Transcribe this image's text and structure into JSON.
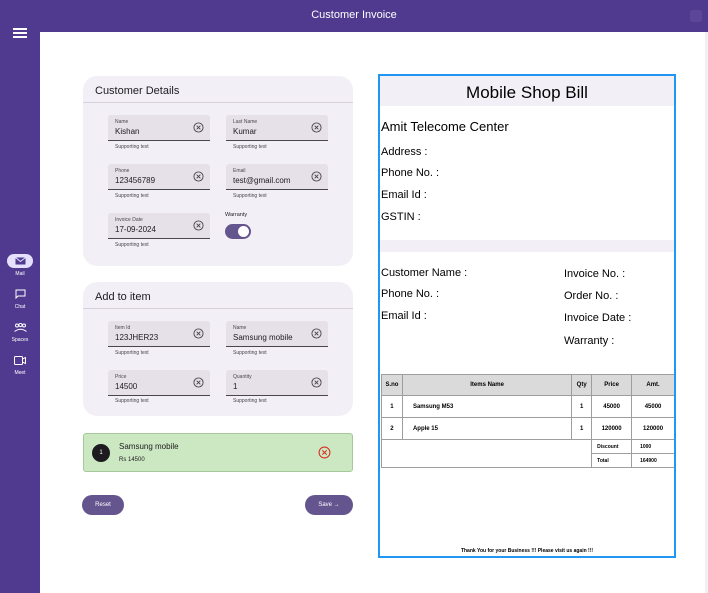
{
  "app": {
    "title": "Customer Invoice"
  },
  "nav": [
    {
      "label": "Mail",
      "icon": "mail-icon"
    },
    {
      "label": "Chat",
      "icon": "chat-icon"
    },
    {
      "label": "Spaces",
      "icon": "spaces-icon"
    },
    {
      "label": "Meet",
      "icon": "meet-icon"
    }
  ],
  "customer": {
    "title": "Customer Details",
    "name": {
      "label": "Name",
      "value": "Kishan",
      "support": "Supporting text"
    },
    "last_name": {
      "label": "Last Name",
      "value": "Kumar",
      "support": "Supporting text"
    },
    "phone": {
      "label": "Phone",
      "value": "123456789",
      "support": "Supporting text"
    },
    "email": {
      "label": "Email",
      "value": "test@gmail.com",
      "support": "Supporting text"
    },
    "invoice_date": {
      "label": "Invoice Date",
      "value": "17-09-2024",
      "support": "Supporting text"
    },
    "warranty": {
      "label": "Warranty",
      "on": true
    }
  },
  "add_item": {
    "title": "Add to item",
    "item_id": {
      "label": "Item Id",
      "value": "123JHER23",
      "support": "Supporting text"
    },
    "name": {
      "label": "Name",
      "value": "Samsung mobile",
      "support": "Supporting text"
    },
    "price": {
      "label": "Price",
      "value": "14500",
      "support": "Supporting text"
    },
    "quantity": {
      "label": "Quantity",
      "value": "1",
      "support": "Supporting text"
    }
  },
  "added_items": [
    {
      "index": "1",
      "name": "Samsung mobile",
      "price": "Rs 14500"
    }
  ],
  "actions": {
    "reset": "Reset",
    "save": "Save →"
  },
  "bill": {
    "title": "Mobile Shop Bill",
    "shop_name": "Amit Telecome Center",
    "address": "Address :",
    "phone": "Phone No. :",
    "email": "Email Id :",
    "gstin": "GSTIN :",
    "customer_name": "Customer Name :",
    "customer_phone": "Phone No. :",
    "customer_email": "Email Id :",
    "invoice_no": "Invoice No. :",
    "order_no": "Order No. :",
    "invoice_date": "Invoice Date :",
    "warranty": "Warranty :",
    "columns": [
      "S.no",
      "Items Name",
      "Qty",
      "Price",
      "Amt."
    ],
    "rows": [
      [
        "1",
        "Samsung M53",
        "1",
        "45000",
        "45000"
      ],
      [
        "2",
        "Apple 15",
        "1",
        "120000",
        "120000"
      ]
    ],
    "discount_label": "Discount",
    "discount_value": "1000",
    "total_label": "Total",
    "total_value": "164900",
    "footer": "Thank You for your Business !!! Please visit us again !!!"
  },
  "colors": {
    "primary": "#4f3a8f",
    "accent": "#65558f",
    "highlight_border": "#2196f3",
    "item_bg": "#cce8c2"
  }
}
